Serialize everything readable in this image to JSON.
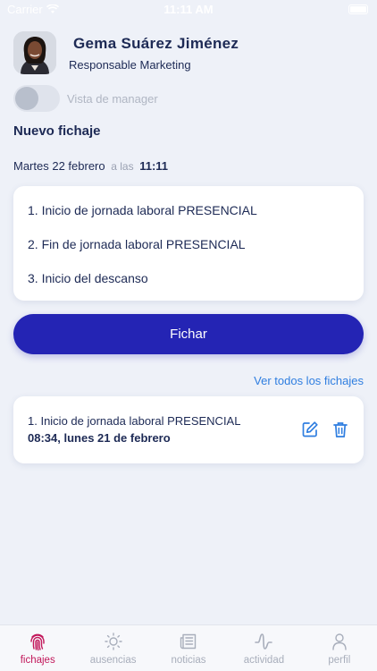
{
  "status_bar": {
    "carrier": "Carrier",
    "time": "11:11 AM"
  },
  "profile": {
    "name": "Gema Suárez Jiménez",
    "role": "Responsable Marketing"
  },
  "manager_toggle": {
    "label": "Vista de manager",
    "on": false
  },
  "new_entry": {
    "title": "Nuevo fichaje",
    "date": "Martes 22 febrero",
    "at": "a las",
    "time": "11:11"
  },
  "options": [
    "1. Inicio de jornada laboral PRESENCIAL",
    "2. Fin de jornada laboral PRESENCIAL",
    "3. Inicio del descanso"
  ],
  "fichar_label": "Fichar",
  "see_all_label": "Ver todos los fichajes",
  "last_record": {
    "title": "1. Inicio de jornada laboral PRESENCIAL",
    "datetime": "08:34, lunes 21 de febrero"
  },
  "tabs": [
    {
      "label": "fichajes",
      "icon": "fingerprint-icon",
      "active": true
    },
    {
      "label": "ausencias",
      "icon": "sun-icon",
      "active": false
    },
    {
      "label": "noticias",
      "icon": "newspaper-icon",
      "active": false
    },
    {
      "label": "actividad",
      "icon": "activity-wave-icon",
      "active": false
    },
    {
      "label": "perfil",
      "icon": "person-icon",
      "active": false
    }
  ],
  "colors": {
    "primary": "#2424b4",
    "text": "#1d2a55",
    "link": "#2f7ee0",
    "active_tab": "#c2185b",
    "background": "#eef1f8"
  }
}
